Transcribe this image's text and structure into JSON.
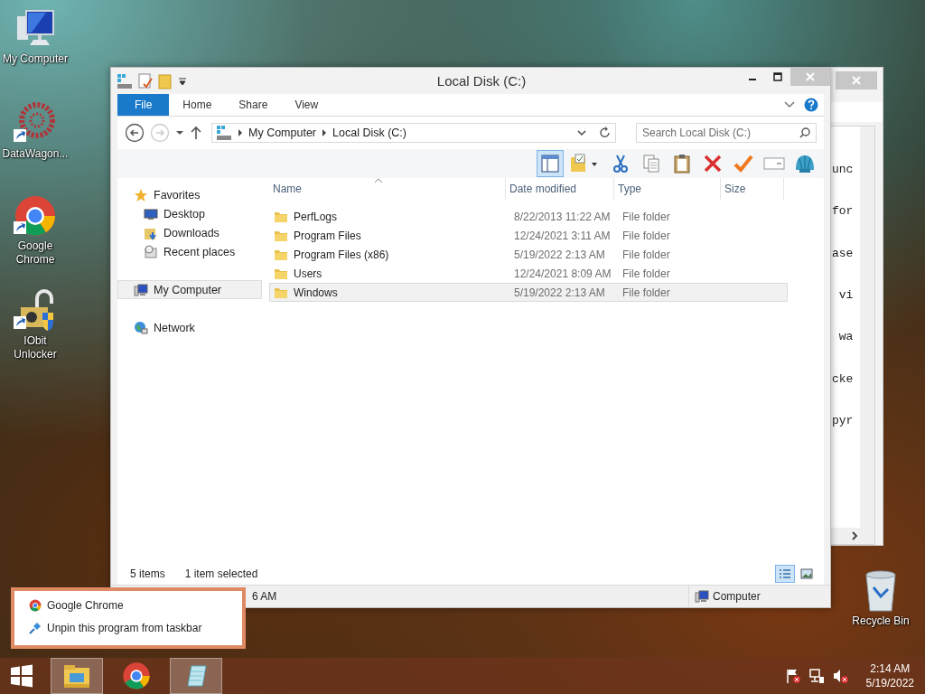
{
  "desktop_icons": [
    {
      "kind": "computer",
      "label": "My Computer"
    },
    {
      "kind": "datawagon",
      "label": "DataWagon..."
    },
    {
      "kind": "chrome",
      "label": "Google Chrome"
    },
    {
      "kind": "unlocker",
      "label": "IObit Unlocker"
    }
  ],
  "back_window": {
    "lines": [
      "unc",
      "for",
      "ase",
      " vi",
      " wa",
      "cke",
      "pyr"
    ]
  },
  "window": {
    "title": "Local Disk (C:)",
    "ribbon_tabs": [
      {
        "kind": "file",
        "label": "File"
      },
      {
        "kind": "tab",
        "label": "Home"
      },
      {
        "kind": "tab",
        "label": "Share"
      },
      {
        "kind": "tab",
        "label": "View"
      }
    ],
    "address": {
      "crumbs": [
        "My Computer",
        "Local Disk (C:)"
      ]
    },
    "search": {
      "placeholder": "Search Local Disk (C:)"
    },
    "toolbar": [
      {
        "kind": "layout",
        "selected": true
      },
      {
        "kind": "folder",
        "selected": false
      },
      {
        "kind": "cut",
        "selected": false
      },
      {
        "kind": "copy",
        "selected": false
      },
      {
        "kind": "paste",
        "selected": false
      },
      {
        "kind": "delete",
        "selected": false
      },
      {
        "kind": "check",
        "selected": false
      },
      {
        "kind": "rename",
        "selected": false
      },
      {
        "kind": "shell",
        "selected": false
      }
    ],
    "nav": [
      {
        "kind": "favorites",
        "label": "Favorites",
        "selected": false,
        "children": [
          {
            "kind": "desktop",
            "label": "Desktop",
            "selected": false
          },
          {
            "kind": "downloads",
            "label": "Downloads",
            "selected": false
          },
          {
            "kind": "recent",
            "label": "Recent places",
            "selected": false
          }
        ]
      },
      {
        "kind": "computer",
        "label": "My Computer",
        "selected": true
      },
      {
        "kind": "network",
        "label": "Network",
        "selected": false
      }
    ],
    "columns": [
      "Name",
      "Date modified",
      "Type",
      "Size"
    ],
    "rows": [
      {
        "name": "PerfLogs",
        "date": "8/22/2013 11:22 AM",
        "type": "File folder",
        "selected": false
      },
      {
        "name": "Program Files",
        "date": "12/24/2021 3:11 AM",
        "type": "File folder",
        "selected": false
      },
      {
        "name": "Program Files (x86)",
        "date": "5/19/2022 2:13 AM",
        "type": "File folder",
        "selected": false
      },
      {
        "name": "Users",
        "date": "12/24/2021 8:09 AM",
        "type": "File folder",
        "selected": false
      },
      {
        "name": "Windows",
        "date": "5/19/2022 2:13 AM",
        "type": "File folder",
        "selected": true
      }
    ],
    "status": {
      "count": "5 items",
      "selection": "1 item selected"
    },
    "views": [
      {
        "kind": "details",
        "selected": true
      },
      {
        "kind": "thumbnails",
        "selected": false
      }
    ],
    "details_bar": {
      "left": "6 AM",
      "right": "Computer"
    }
  },
  "jump_list": [
    {
      "kind": "chrome",
      "label": "Google Chrome"
    },
    {
      "kind": "unpin",
      "label": "Unpin this program from taskbar"
    }
  ],
  "recycle_bin": {
    "label": "Recycle Bin"
  },
  "taskbar": {
    "apps": [
      {
        "kind": "explorer",
        "active": true
      },
      {
        "kind": "chrome",
        "active": false
      },
      {
        "kind": "notepad",
        "active": true
      }
    ],
    "clock": {
      "time": "2:14 AM",
      "date": "5/19/2022"
    }
  }
}
